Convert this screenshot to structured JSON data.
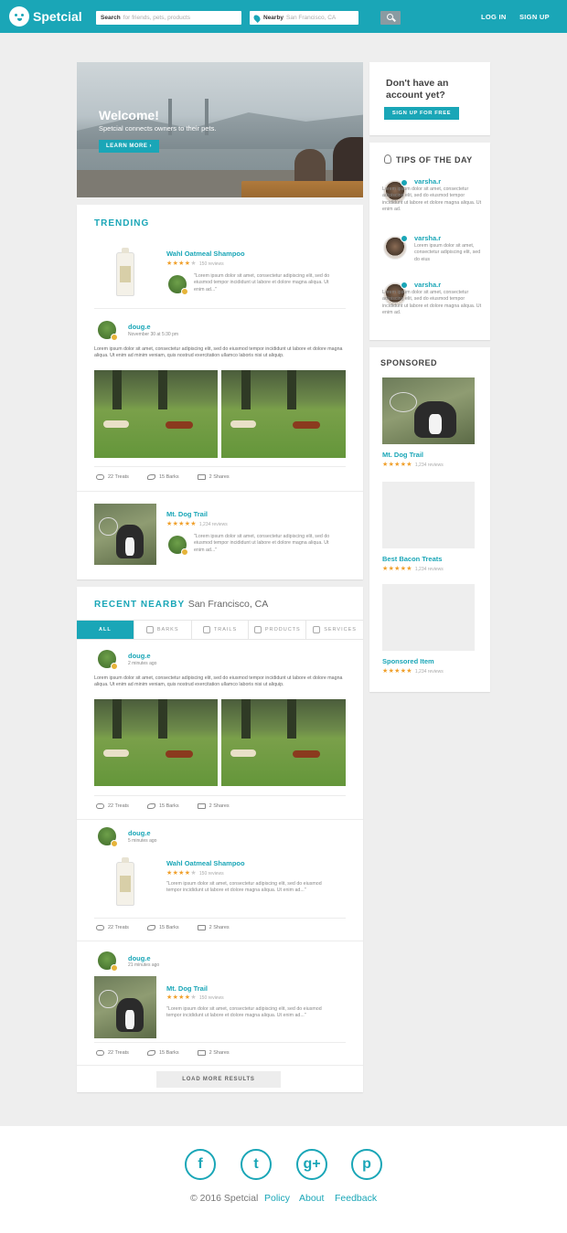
{
  "header": {
    "logo": "Spetcial",
    "search_label": "Search",
    "search_placeholder": "for friends, pets, products",
    "nearby_label": "Nearby",
    "nearby_value": "San Francisco, CA",
    "login": "LOG IN",
    "signup": "SIGN UP"
  },
  "hero": {
    "title": "Welcome!",
    "subtitle": "Spetcial connects owners to their pets.",
    "button": "LEARN MORE ›"
  },
  "trending": {
    "title": "TRENDING",
    "product": {
      "name": "Wahl Oatmeal Shampoo",
      "stars": "★★★★",
      "stars_off": "★",
      "reviews": "150 reviews",
      "quote": "\"Lorem ipsum dolor sit amet, consectetur adipiscing elit, sed do eiusmod tempor incididunt ut labore et dolore magna aliqua. Ut enim ad...\""
    },
    "post": {
      "user": "doug.e",
      "time": "November 30 at 5:30 pm",
      "text": "Lorem ipsum dolor sit amet, consectetur adipiscing elit, sed do eiusmod tempor incididunt ut labore et dolore magna aliqua. Ut enim ad minim veniam, quis nostrud exercitation ullamco laboris nisi ut aliquip.",
      "treats": "22 Treats",
      "barks": "15 Barks",
      "shares": "2 Shares"
    },
    "trail": {
      "name": "Mt. Dog Trail",
      "stars": "★★★★★",
      "reviews": "1,234 reviews",
      "quote": "\"Lorem ipsum dolor sit amet, consectetur adipiscing elit, sed do eiusmod tempor incididunt ut labore et dolore magna aliqua. Ut enim ad...\""
    }
  },
  "nearby": {
    "title": "RECENT NEARBY",
    "location": "San Francisco, CA",
    "tabs": [
      "ALL",
      "BARKS",
      "TRAILS",
      "PRODUCTS",
      "SERVICES"
    ],
    "post1": {
      "user": "doug.e",
      "time": "2 minutes ago",
      "text": "Lorem ipsum dolor sit amet, consectetur adipiscing elit, sed do eiusmod tempor incididunt ut labore et dolore magna aliqua. Ut enim ad minim veniam, quis nostrud exercitation ullamco laboris nisi ut aliquip.",
      "treats": "22 Treats",
      "barks": "15 Barks",
      "shares": "2 Shares"
    },
    "post2": {
      "user": "doug.e",
      "time": "5 minutes ago",
      "product": "Wahl Oatmeal Shampoo",
      "stars": "★★★★",
      "stars_off": "★",
      "reviews": "150 reviews",
      "quote": "\"Lorem ipsum dolor sit amet, consectetur adipiscing elit, sed do eiusmod tempor incididunt ut labore et dolore magna aliqua. Ut enim ad...\"",
      "treats": "22 Treats",
      "barks": "15 Barks",
      "shares": "2 Shares"
    },
    "post3": {
      "user": "doug.e",
      "time": "21 minutes ago",
      "trail": "Mt. Dog Trail",
      "stars": "★★★★",
      "stars_off": "★",
      "reviews": "150 reviews",
      "quote": "\"Lorem ipsum dolor sit amet, consectetur adipiscing elit, sed do eiusmod tempor incididunt ut labore et dolore magna aliqua. Ut enim ad...\"",
      "treats": "22 Treats",
      "barks": "15 Barks",
      "shares": "2 Shares"
    },
    "load_more": "LOAD MORE RESULTS"
  },
  "signup_box": {
    "heading": "Don't have an account yet?",
    "button": "SIGN UP FOR FREE"
  },
  "tips": {
    "title": "TIPS OF THE DAY",
    "items": [
      {
        "user": "varsha.r",
        "text": "Lorem ipsum dolor sit amet, consectetur adipiscing elit, sed do eiusmod tempor incididunt ut labore et dolore magna aliqua. Ut enim ad."
      },
      {
        "user": "varsha.r",
        "text": "Lorem ipsum dolor sit amet, consectetur adipiscing elit, sed do eius"
      },
      {
        "user": "varsha.r",
        "text": "Lorem ipsum dolor sit amet, consectetur adipiscing elit, sed do eiusmod tempor incididunt ut labore et dolore magna aliqua. Ut enim ad."
      }
    ]
  },
  "sponsored": {
    "title": "SPONSORED",
    "items": [
      {
        "name": "Mt. Dog Trail",
        "stars": "★★★★★",
        "reviews": "1,234 reviews"
      },
      {
        "name": "Best Bacon Treats",
        "stars": "★★★★★",
        "reviews": "1,234 reviews"
      },
      {
        "name": "Sponsored Item",
        "stars": "★★★★★",
        "reviews": "1,234 reviews"
      }
    ]
  },
  "footer": {
    "social": [
      "facebook-icon",
      "twitter-icon",
      "google-plus-icon",
      "pinterest-icon"
    ],
    "social_glyphs": [
      "f",
      "t",
      "g+",
      "p"
    ],
    "copyright": "© 2016 Spetcial",
    "links": [
      "Policy",
      "About",
      "Feedback"
    ]
  },
  "colors": {
    "brand": "#1aa6b7",
    "stars": "#f0a02c",
    "background": "#eeeeee"
  }
}
